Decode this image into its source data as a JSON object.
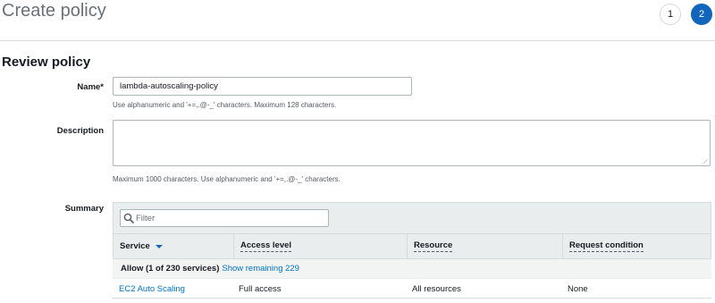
{
  "header": {
    "title": "Create policy",
    "steps": [
      "1",
      "2"
    ]
  },
  "review": {
    "section_title": "Review policy",
    "name": {
      "label": "Name*",
      "value": "lambda-autoscaling-policy",
      "hint": "Use alphanumeric and '+=,.@-_' characters. Maximum 128 characters."
    },
    "description": {
      "label": "Description",
      "value": "",
      "hint": "Maximum 1000 characters. Use alphanumeric and '+=,.@-_' characters."
    },
    "summary": {
      "label": "Summary",
      "filter_placeholder": "Filter",
      "columns": [
        "Service",
        "Access level",
        "Resource",
        "Request condition"
      ],
      "group": {
        "label": "Allow (1 of 230 services)",
        "link": "Show remaining 229"
      },
      "rows": [
        {
          "service": "EC2 Auto Scaling",
          "access_level": "Full access",
          "resource": "All resources",
          "request_condition": "None"
        }
      ]
    }
  },
  "colors": {
    "accent": "#1166bb",
    "link": "#0073bb",
    "header_bg": "#eaeded"
  },
  "icons": {
    "filter": "search-icon",
    "sort": "caret-down-icon"
  }
}
